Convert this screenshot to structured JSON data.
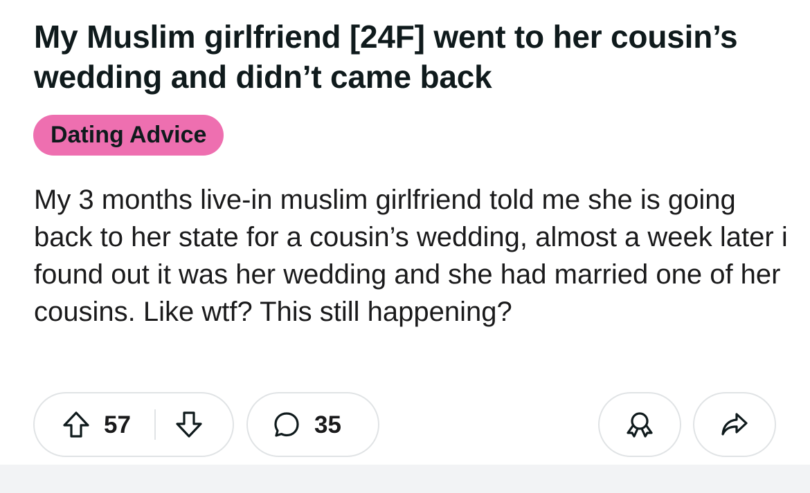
{
  "post": {
    "title": "My Muslim girlfriend [24F] went to her cousin’s wedding and didn’t came back",
    "flair": {
      "label": "Dating Advice",
      "color": "#ee6fb0"
    },
    "body": "My 3 months live-in muslim girlfriend told me she is going back to her state for a cousin’s wedding, almost a week later i found out it was her wedding and she had married one of her cousins. Like wtf? This still happening?"
  },
  "actions": {
    "upvote_icon": "upvote-arrow-icon",
    "vote_count": "57",
    "downvote_icon": "downvote-arrow-icon",
    "comment_icon": "comment-bubble-icon",
    "comment_count": "35",
    "award_icon": "award-icon",
    "share_icon": "share-arrow-icon"
  },
  "colors": {
    "text": "#0f1a1c",
    "pill_border": "#e0e3e5",
    "background": "#ffffff",
    "footer_strip": "#f2f3f5"
  }
}
